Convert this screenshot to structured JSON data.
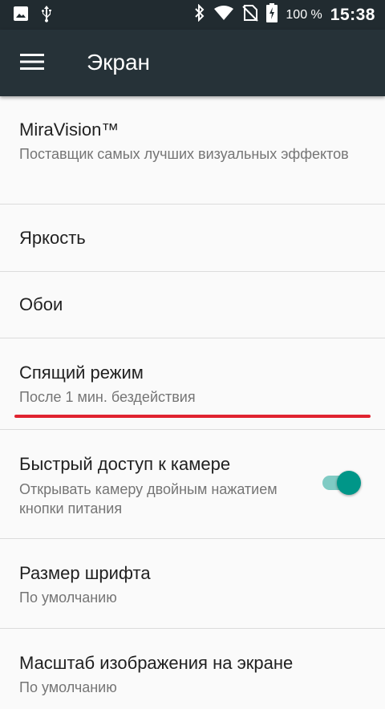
{
  "status_bar": {
    "icons_left": [
      "image-icon",
      "usb-icon"
    ],
    "icons_right": [
      "bluetooth-icon",
      "wifi-icon",
      "no-sim-icon",
      "battery-charging-icon"
    ],
    "battery_text": "100 %",
    "time": "15:38"
  },
  "app_bar": {
    "title": "Экран",
    "menu_icon": "hamburger-menu-icon"
  },
  "settings": {
    "items": [
      {
        "title": "MiraVision™",
        "summary": "Поставщик самых лучших визуальных эффектов"
      },
      {
        "title": "Яркость"
      },
      {
        "title": "Обои"
      },
      {
        "title": "Спящий режим",
        "summary": "После 1 мин. бездействия"
      },
      {
        "title": "Быстрый доступ к камере",
        "summary": "Открывать камеру двойным нажатием кнопки питания",
        "toggle_on": true
      },
      {
        "title": "Размер шрифта",
        "summary": "По умолчанию"
      },
      {
        "title": "Масштаб изображения на экране",
        "summary": "По умолчанию"
      }
    ]
  },
  "colors": {
    "status_bar_bg": "#212b30",
    "app_bar_bg": "#263238",
    "accent": "#009688",
    "highlight_underline": "#e02430"
  }
}
